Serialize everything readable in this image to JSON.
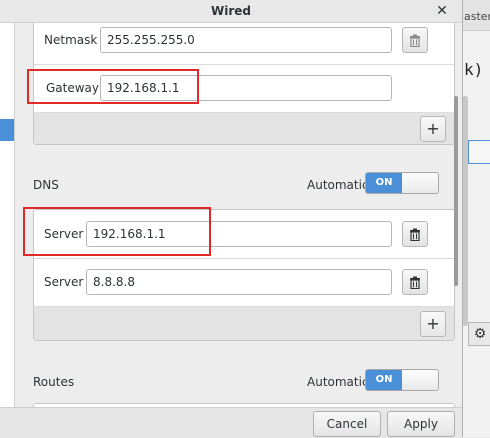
{
  "background_window": {
    "title_snippet": "aster",
    "text_snippet": "k)"
  },
  "dialog": {
    "title": "Wired"
  },
  "ipv4": {
    "rows": [
      {
        "label": "Netmask",
        "value": "255.255.255.0"
      },
      {
        "label": "Gateway",
        "value": "192.168.1.1"
      }
    ],
    "add_label": "+"
  },
  "dns": {
    "label": "DNS",
    "automatic_label": "Automatic",
    "switch_label": "ON",
    "rows": [
      {
        "label": "Server",
        "value": "192.168.1.1"
      },
      {
        "label": "Server",
        "value": "8.8.8.8"
      }
    ],
    "add_label": "+"
  },
  "routes": {
    "label": "Routes",
    "automatic_label": "Automatic",
    "switch_label": "ON"
  },
  "footer": {
    "cancel_label": "Cancel",
    "apply_label": "Apply"
  },
  "icons": {
    "close": "close-icon",
    "trash": "trash-icon",
    "add": "add-icon",
    "gear": "gear-icon"
  },
  "colors": {
    "accent": "#4a90d9",
    "highlight": "#e02a2a"
  }
}
